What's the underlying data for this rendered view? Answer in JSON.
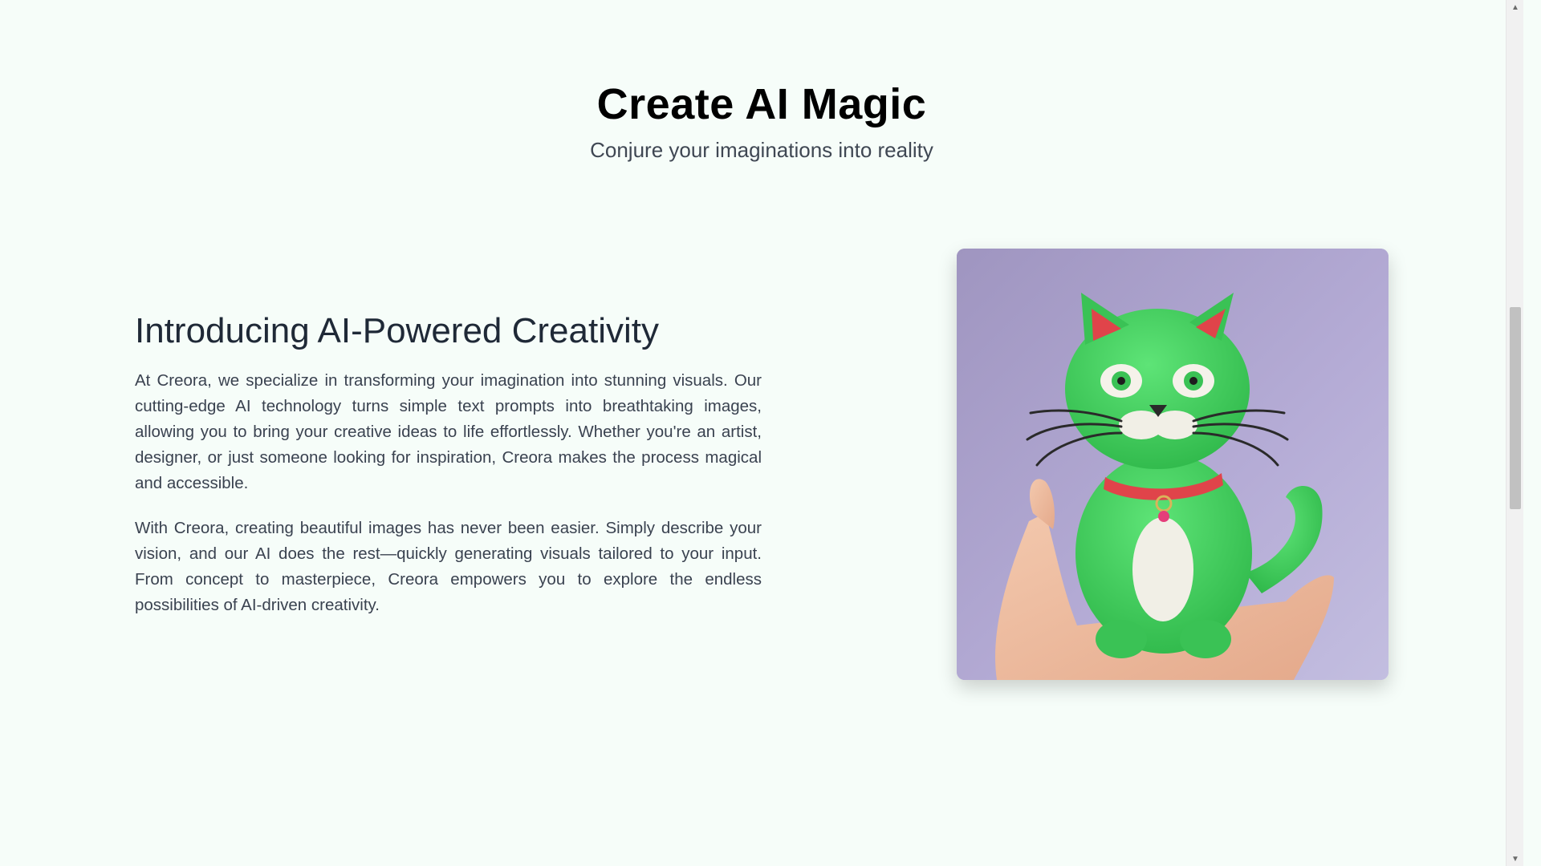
{
  "hero": {
    "title": "Create AI Magic",
    "subtitle": "Conjure your imaginations into reality"
  },
  "intro": {
    "heading": "Introducing AI-Powered Creativity",
    "paragraphs": [
      "At Creora, we specialize in transforming your imagination into stunning visuals. Our cutting-edge AI technology turns simple text prompts into breathtaking images, allowing you to bring your creative ideas to life effortlessly. Whether you're an artist, designer, or just someone looking for inspiration, Creora makes the process magical and accessible.",
      "With Creora, creating beautiful images has never been easier. Simply describe your vision, and our AI does the rest—quickly generating visuals tailored to your input. From concept to masterpiece, Creora empowers you to explore the endless possibilities of AI-driven creativity."
    ]
  },
  "image": {
    "subject": "green clay cat figurine held in a hand",
    "background_color": "#b3aad3",
    "cat_color": "#3fcf5a",
    "collar_color": "#e0444a"
  },
  "scrollbar": {
    "up_icon": "triangle-up-icon",
    "down_icon": "triangle-down-icon"
  }
}
